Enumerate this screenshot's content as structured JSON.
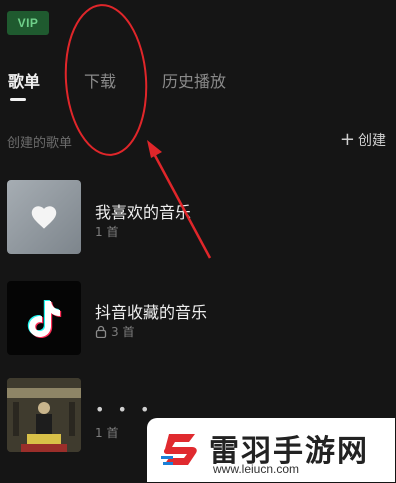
{
  "header": {
    "vip_label": "VIP"
  },
  "tabs": [
    {
      "label": "歌单",
      "active": true
    },
    {
      "label": "下载",
      "active": false
    },
    {
      "label": "历史播放",
      "active": false
    }
  ],
  "section": {
    "label": "创建的歌单",
    "create_label": "创建"
  },
  "playlists": [
    {
      "title": "我喜欢的音乐",
      "count": "1 首",
      "cover_icon": "heart-icon",
      "locked": false
    },
    {
      "title": "抖音收藏的音乐",
      "count": "3 首",
      "cover_icon": "douyin-logo-icon",
      "locked": true
    },
    {
      "title": "• • •",
      "count": "1 首",
      "cover_icon": "album-art",
      "locked": false
    }
  ],
  "watermark": {
    "brand": "雷羽手游网",
    "url": "www.leiucn.com"
  },
  "colors": {
    "background": "#151515",
    "annotation": "#e0262a",
    "vip": "#1f5a2f"
  }
}
